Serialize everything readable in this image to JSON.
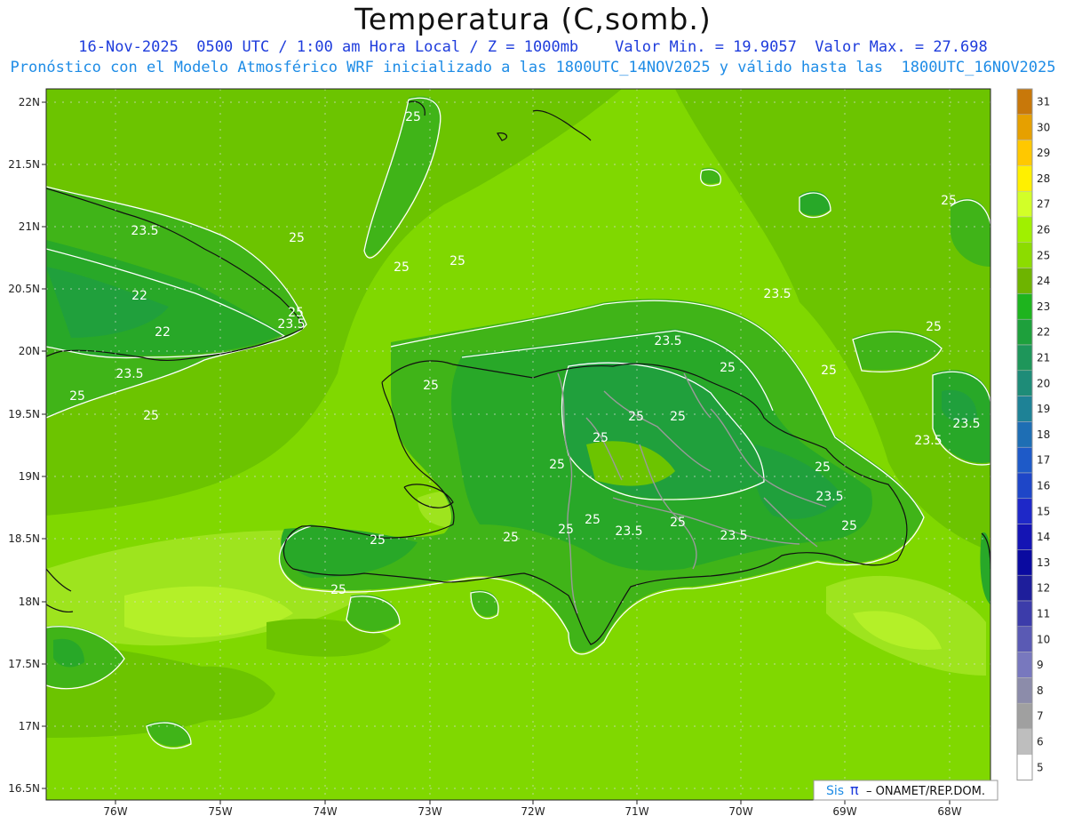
{
  "header": {
    "title": "Temperatura (C,somb.)",
    "line1": "16-Nov-2025  0500 UTC / 1:00 am Hora Local / Z = 1000mb    Valor Min. = 19.9057  Valor Max. = 27.698",
    "line2": "Pronóstico con el Modelo Atmosférico WRF inicializado a las 1800UTC_14NOV2025 y válido hasta las  1800UTC_16NOV2025"
  },
  "axes": {
    "lon_ticks": [
      "76W",
      "75W",
      "74W",
      "73W",
      "72W",
      "71W",
      "70W",
      "69W",
      "68W"
    ],
    "lat_ticks": [
      "22N",
      "21.5N",
      "21N",
      "20.5N",
      "20N",
      "19.5N",
      "19N",
      "18.5N",
      "18N",
      "17.5N",
      "17N",
      "16.5N"
    ]
  },
  "colorbar": {
    "levels": [
      "31",
      "30",
      "29",
      "28",
      "27",
      "26",
      "25",
      "24",
      "23",
      "22",
      "21",
      "20",
      "19",
      "18",
      "17",
      "16",
      "15",
      "14",
      "13",
      "12",
      "11",
      "10",
      "9",
      "8",
      "7",
      "6",
      "5"
    ],
    "colors": [
      "#c8780a",
      "#e6a000",
      "#ffc800",
      "#fff000",
      "#d2ff28",
      "#a0f000",
      "#8cdc00",
      "#6eb400",
      "#1eb41e",
      "#1ea03c",
      "#1e965a",
      "#1e8c78",
      "#1e8296",
      "#1e6eb4",
      "#1e5ac8",
      "#1e46c8",
      "#1e28c8",
      "#1414b4",
      "#0a0aa0",
      "#1e1e9b",
      "#3c3caa",
      "#5a5ab4",
      "#7878be",
      "#8c8caa",
      "#a0a0a0",
      "#bebebe",
      "#ffffff"
    ]
  },
  "field": {
    "colors": [
      "#80d800",
      "#9ee41e",
      "#b4f028",
      "#6cc400",
      "#40b418",
      "#28a828",
      "#20a03c"
    ]
  },
  "contour_labels": [
    "25",
    "23.5",
    "25",
    "25",
    "25",
    "22",
    "22",
    "23.5",
    "25",
    "23.5",
    "25",
    "25",
    "25",
    "23.5",
    "25",
    "25",
    "25",
    "25",
    "23.5",
    "23.5",
    "25",
    "23.5",
    "25",
    "25",
    "23.5",
    "25",
    "25",
    "25",
    "23.5",
    "23.5",
    "25",
    "25",
    "25",
    "25",
    "25",
    "25"
  ],
  "credit": {
    "logo": "Sis",
    "pi": "π",
    "text": "– ONAMET/REP.DOM."
  }
}
